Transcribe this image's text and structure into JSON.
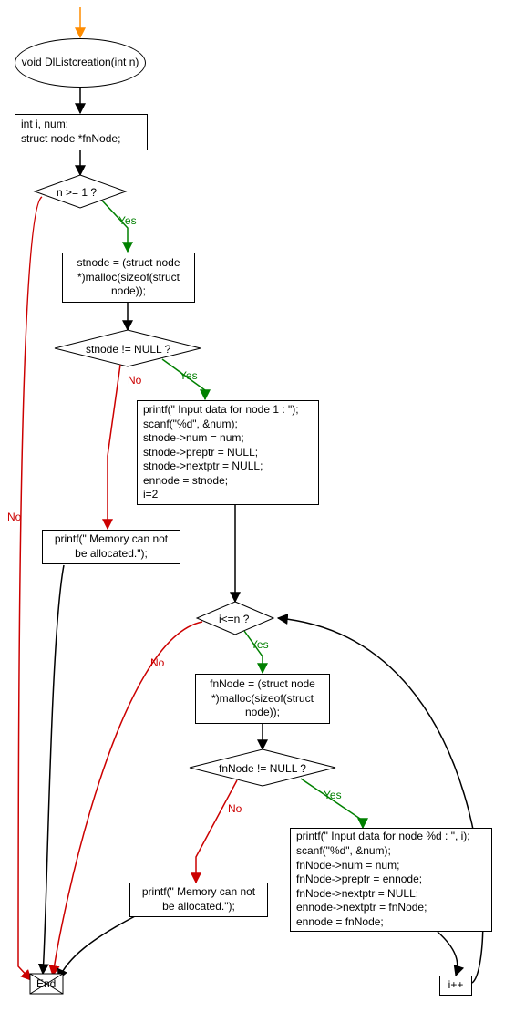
{
  "chart_data": {
    "type": "flowchart",
    "nodes": [
      {
        "id": "entry",
        "shape": "start-arrow"
      },
      {
        "id": "funcdecl",
        "shape": "ellipse",
        "text": "void DlListcreation(int n)"
      },
      {
        "id": "decl",
        "shape": "process",
        "text": "int i, num;\nstruct node *fnNode;"
      },
      {
        "id": "cond_n",
        "shape": "decision",
        "text": "n >= 1 ?"
      },
      {
        "id": "malloc_st",
        "shape": "process",
        "text": "stnode = (struct node *)malloc(sizeof(struct node));"
      },
      {
        "id": "cond_st",
        "shape": "decision",
        "text": "stnode != NULL ?"
      },
      {
        "id": "init_st",
        "shape": "process",
        "text": "printf(\" Input data for node 1 : \");\nscanf(\"%d\", &num);\nstnode->num = num;\nstnode->preptr = NULL;\nstnode->nextptr = NULL;\nennode = stnode;\ni=2"
      },
      {
        "id": "mem_err1",
        "shape": "process",
        "text": "printf(\" Memory can not be allocated.\");"
      },
      {
        "id": "cond_loop",
        "shape": "decision",
        "text": "i<=n ?"
      },
      {
        "id": "malloc_fn",
        "shape": "process",
        "text": "fnNode = (struct node *)malloc(sizeof(struct node));"
      },
      {
        "id": "cond_fn",
        "shape": "decision",
        "text": "fnNode != NULL ?"
      },
      {
        "id": "loop_body",
        "shape": "process",
        "text": "printf(\" Input data for node %d : \", i);\nscanf(\"%d\", &num);\nfnNode->num = num;\nfnNode->preptr = ennode;\nfnNode->nextptr = NULL;\nennode->nextptr = fnNode;\nennode = fnNode;"
      },
      {
        "id": "mem_err2",
        "shape": "process",
        "text": "printf(\" Memory can not be allocated.\");"
      },
      {
        "id": "incr",
        "shape": "process",
        "text": "i++"
      },
      {
        "id": "end",
        "shape": "end",
        "text": "End"
      }
    ],
    "edges": [
      {
        "from": "entry",
        "to": "funcdecl"
      },
      {
        "from": "funcdecl",
        "to": "decl"
      },
      {
        "from": "decl",
        "to": "cond_n"
      },
      {
        "from": "cond_n",
        "to": "malloc_st",
        "label": "Yes"
      },
      {
        "from": "cond_n",
        "to": "end",
        "label": "No"
      },
      {
        "from": "malloc_st",
        "to": "cond_st"
      },
      {
        "from": "cond_st",
        "to": "init_st",
        "label": "Yes"
      },
      {
        "from": "cond_st",
        "to": "mem_err1",
        "label": "No"
      },
      {
        "from": "mem_err1",
        "to": "end"
      },
      {
        "from": "init_st",
        "to": "cond_loop"
      },
      {
        "from": "cond_loop",
        "to": "malloc_fn",
        "label": "Yes"
      },
      {
        "from": "cond_loop",
        "to": "end",
        "label": "No"
      },
      {
        "from": "malloc_fn",
        "to": "cond_fn"
      },
      {
        "from": "cond_fn",
        "to": "loop_body",
        "label": "Yes"
      },
      {
        "from": "cond_fn",
        "to": "mem_err2",
        "label": "No"
      },
      {
        "from": "mem_err2",
        "to": "end"
      },
      {
        "from": "loop_body",
        "to": "incr"
      },
      {
        "from": "incr",
        "to": "cond_loop"
      }
    ],
    "labels": {
      "yes": "Yes",
      "no": "No"
    }
  }
}
